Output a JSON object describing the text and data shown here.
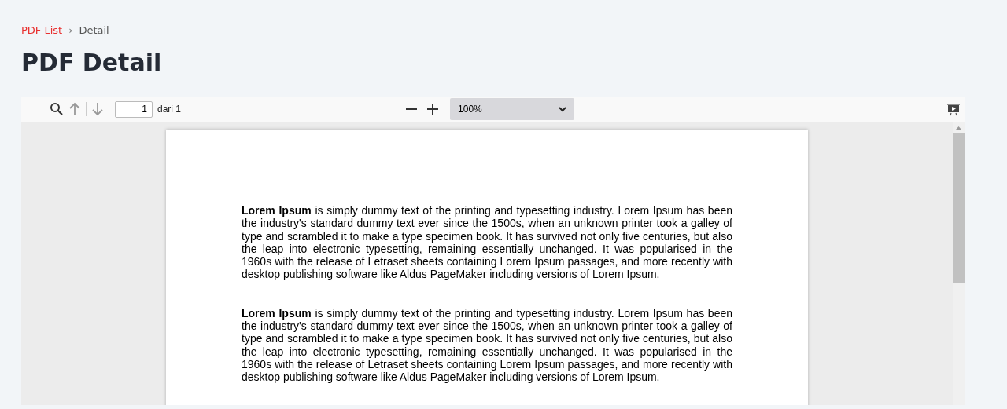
{
  "breadcrumb": [
    {
      "label": "PDF List",
      "link": true
    },
    {
      "label": "Detail",
      "link": false
    }
  ],
  "separator": "›",
  "title": "PDF Detail",
  "viewer": {
    "toolbar": {
      "prev_disabled": true,
      "next_disabled": true,
      "page_value": "1",
      "page_total": "dari 1",
      "zoom": "100%"
    },
    "paragraphs": [
      "**Lorem Ipsum** is simply dummy text of the printing and typesetting industry. Lorem Ipsum has been the industry's standard dummy text ever since the 1500s, when an unknown printer took a galley of type and scrambled it to make a type specimen book. It has survived not only five centuries, but also the leap into electronic typesetting, remaining essentially unchanged. It was popularised in the 1960s with the release of Letraset sheets containing Lorem Ipsum passages, and more recently with desktop publishing software like Aldus PageMaker including versions of Lorem Ipsum.",
      "**Lorem Ipsum** is simply dummy text of the printing and typesetting industry. Lorem Ipsum has been the industry's standard dummy text ever since the 1500s, when an unknown printer took a galley of type and scrambled it to make a type specimen book. It has survived not only five centuries, but also the leap into electronic typesetting, remaining essentially unchanged. It was popularised in the 1960s with the release of Letraset sheets containing Lorem Ipsum passages, and more recently with desktop publishing software like Aldus PageMaker including versions of Lorem Ipsum."
    ]
  }
}
